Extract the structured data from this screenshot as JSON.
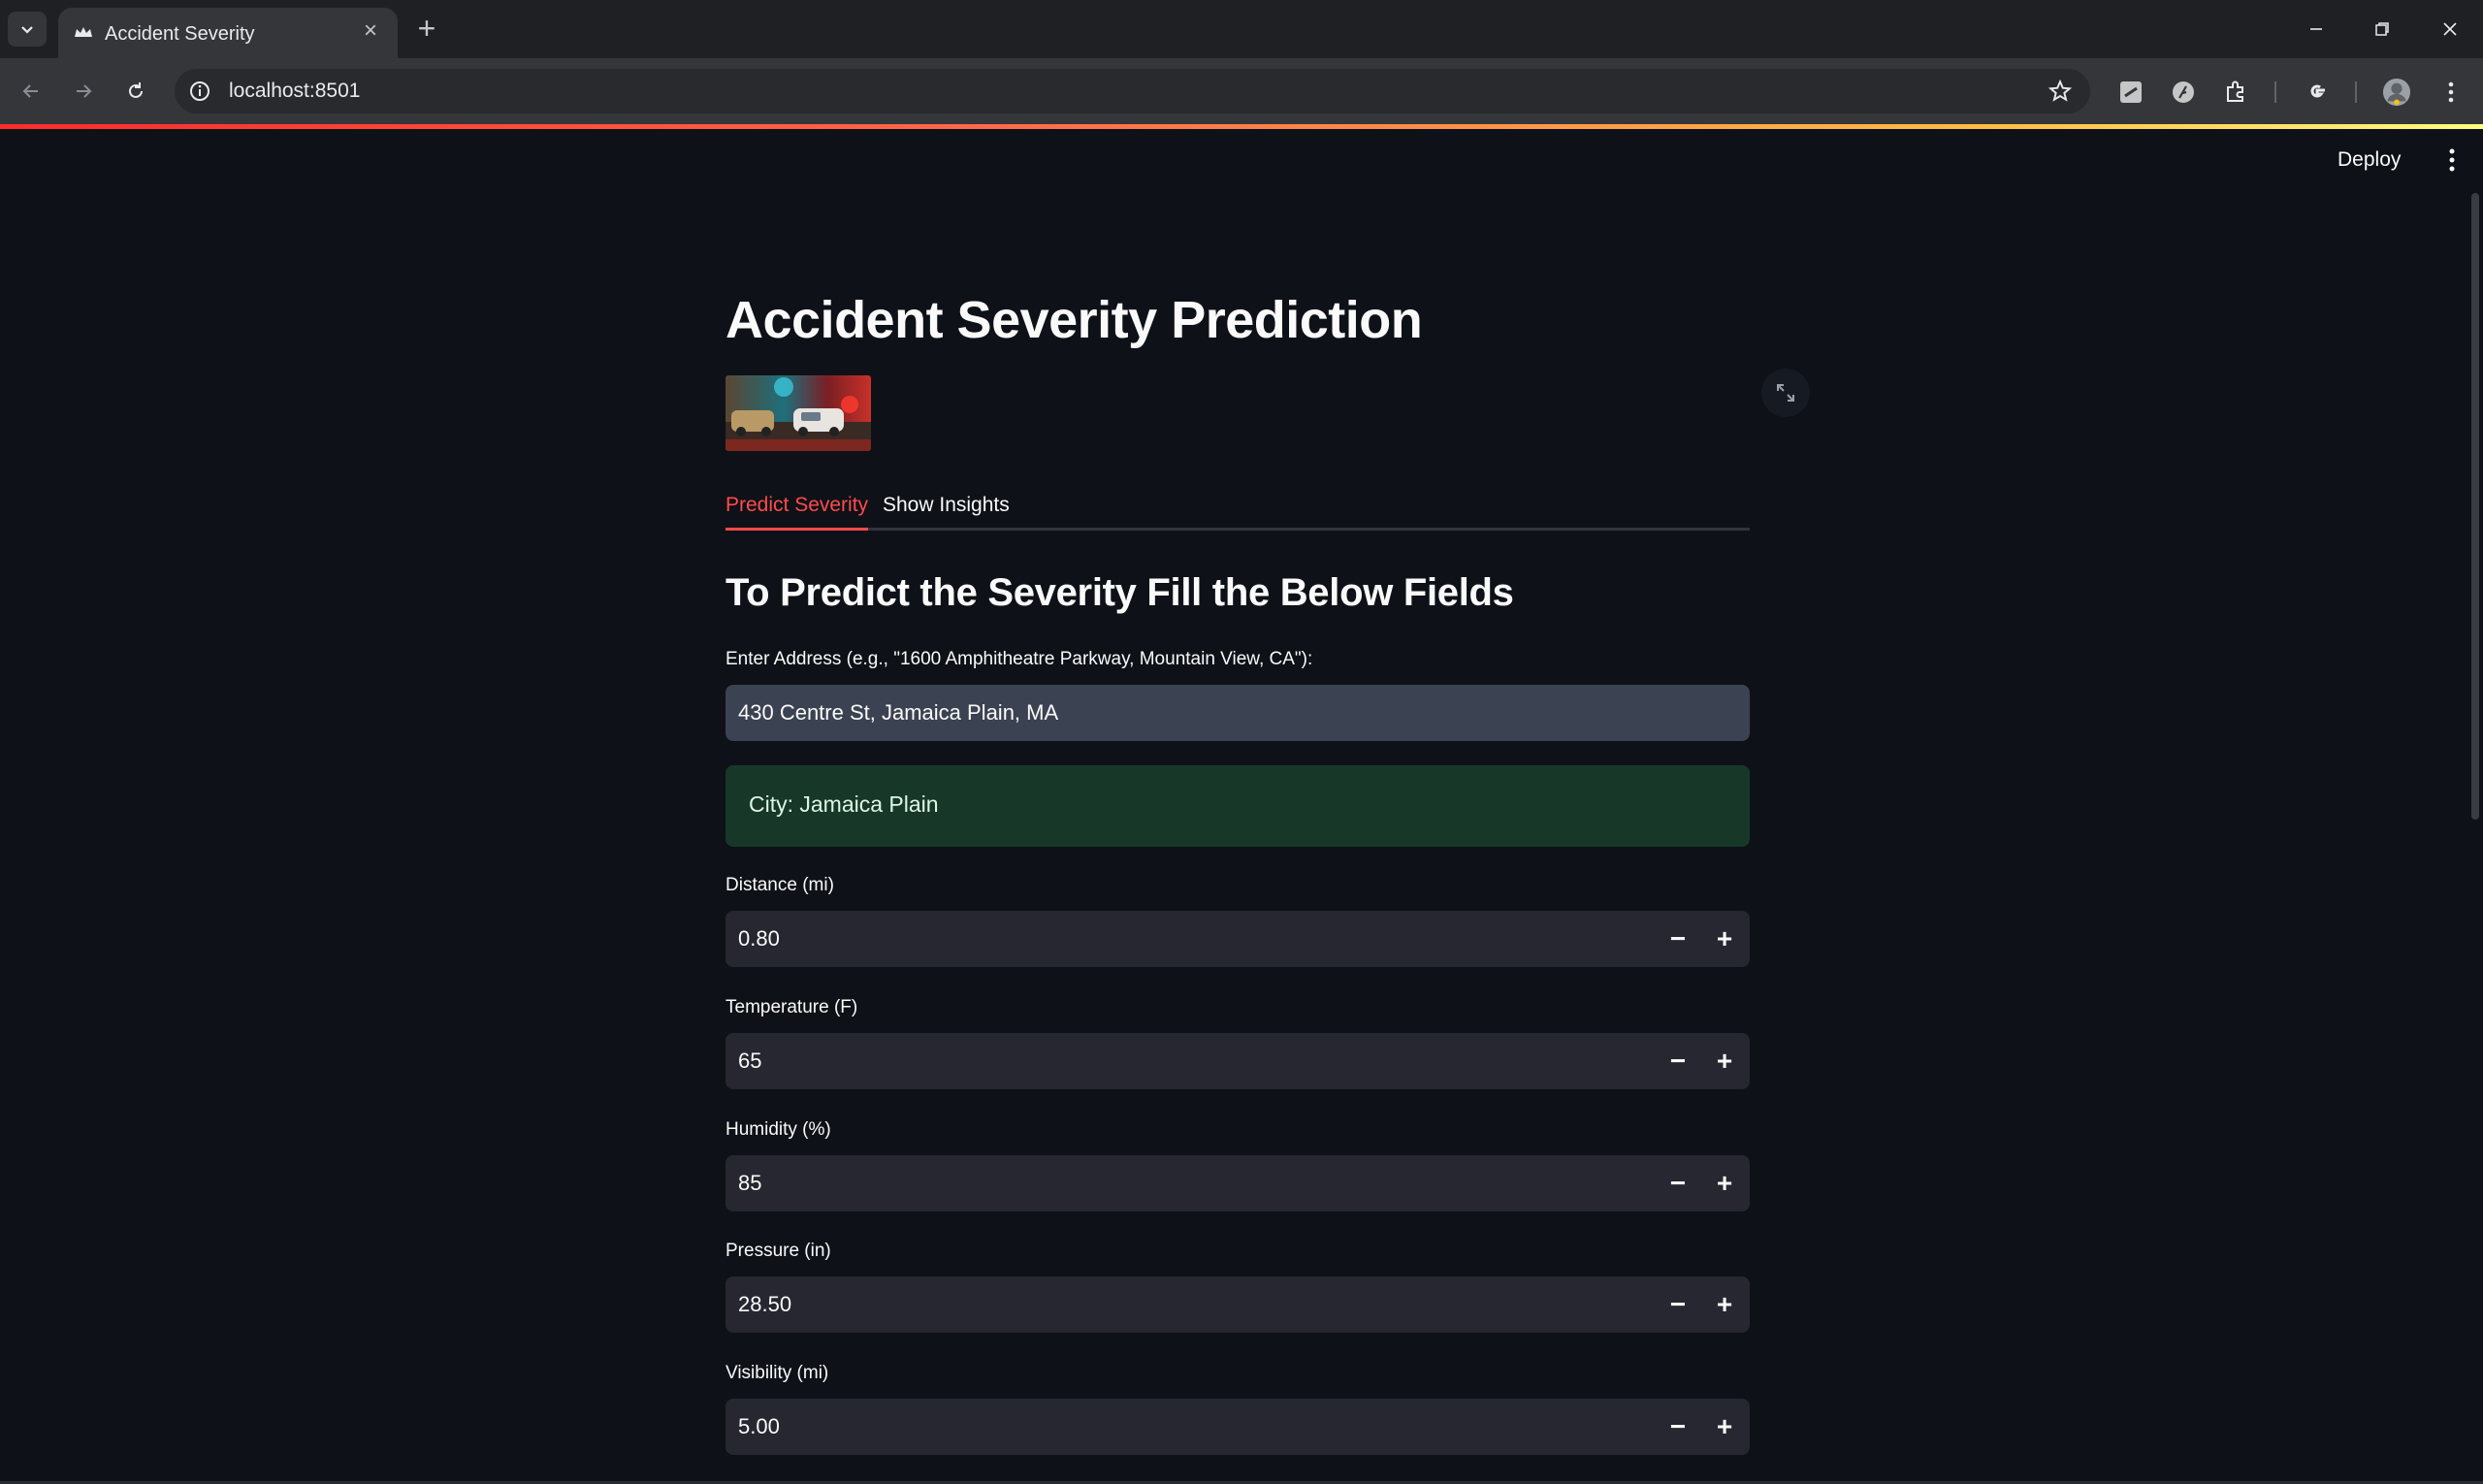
{
  "browser": {
    "tab_title": "Accident Severity",
    "url": "localhost:8501"
  },
  "app": {
    "deploy_label": "Deploy",
    "title": "Accident Severity Prediction",
    "tabs": [
      {
        "label": "Predict Severity",
        "active": true
      },
      {
        "label": "Show Insights",
        "active": false
      }
    ],
    "section_title": "To Predict the Severity Fill the Below Fields",
    "address": {
      "label": "Enter Address (e.g., \"1600 Amphitheatre Parkway, Mountain View, CA\"):",
      "value": "430 Centre St, Jamaica Plain, MA"
    },
    "city_message": "City: Jamaica Plain",
    "fields": [
      {
        "label": "Distance (mi)",
        "value": "0.80"
      },
      {
        "label": "Temperature (F)",
        "value": "65"
      },
      {
        "label": "Humidity (%)",
        "value": "85"
      },
      {
        "label": "Pressure (in)",
        "value": "28.50"
      },
      {
        "label": "Visibility (mi)",
        "value": "5.00"
      }
    ]
  },
  "colors": {
    "accent": "#ff4b4b",
    "background": "#0e1117",
    "success_bg": "#173828"
  }
}
